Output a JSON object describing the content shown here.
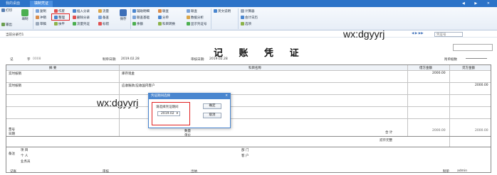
{
  "tabs": [
    "我的桌面",
    "填制凭证"
  ],
  "window_controls": "◀ ▶ ✕",
  "ribbon": {
    "left_small": [
      "打印",
      "输出"
    ],
    "left_big": [
      "填制"
    ],
    "group1": [
      {
        "label": "复制"
      },
      {
        "label": "冲销"
      },
      {
        "label": "草稿"
      }
    ],
    "group2": [
      {
        "label": "作废"
      },
      {
        "label": "整理"
      },
      {
        "label": "扶平"
      }
    ],
    "group3": [
      {
        "label": "插入分录"
      },
      {
        "label": "删除分录"
      },
      {
        "label": "流量凭证"
      }
    ],
    "group4": [
      {
        "label": "流量"
      },
      {
        "label": "备查"
      },
      {
        "label": "标错"
      }
    ],
    "save_big": "保存",
    "group5": [
      {
        "label": "辅助明细"
      },
      {
        "label": "联查基础"
      },
      {
        "label": "余额"
      }
    ],
    "group6": [
      {
        "label": "联查"
      },
      {
        "label": "分单"
      },
      {
        "label": "科目转换"
      }
    ],
    "group7": [
      {
        "label": "联查"
      },
      {
        "label": "数据分析"
      },
      {
        "label": "显示凭证号"
      }
    ],
    "group8": [
      {
        "label": "英文说明"
      }
    ],
    "group9": [
      {
        "label": "计算器"
      },
      {
        "label": "会计日历"
      },
      {
        "label": "选项"
      }
    ]
  },
  "subbar": {
    "label": "当前分录行1",
    "search_placeholder": "凭证号"
  },
  "watermarks": [
    "wx:dgyyrj",
    "wx:dgyyrj"
  ],
  "voucher": {
    "title": "记 账 凭 证",
    "type_label": "记",
    "number_label": "字",
    "number": "0008",
    "date_label": "制单日期:",
    "date": "2019.02.28",
    "audit_label": "审核日期:",
    "audit_date": "2019.02.28",
    "attach_label": "附单据数",
    "headers": {
      "summary": "摘 要",
      "account": "科目名称",
      "debit": "借方金额",
      "credit": "贷方金额"
    },
    "rows": [
      {
        "summary": "实时核销",
        "account": "库存现金",
        "debit": "2000.00",
        "credit": ""
      },
      {
        "summary": "实时核销",
        "account": "应收账款/应收国内客户",
        "debit": "",
        "credit": "2000.00"
      }
    ],
    "footer": {
      "ticket_no": "票号",
      "ticket_date": "日期",
      "qty": "数量",
      "unit_price": "单价",
      "total_label": "合 计",
      "total_debit": "2000.00",
      "total_credit": "2000.00",
      "capital_label": "贰仟元整",
      "remark": "备注",
      "project": "项 目",
      "dept": "部 门",
      "person": "个 人",
      "customer": "客 户",
      "business": "业务员"
    },
    "signature": {
      "bookkeep": "记账",
      "audit": "审核",
      "cashier": "出纳",
      "maker": "制单",
      "maker_name": "admin"
    }
  },
  "dialog": {
    "title": "凭证期间选择",
    "prompt": "请选择凭证期间",
    "period": "2019.02",
    "ok": "确定",
    "cancel": "取消"
  },
  "colors": {
    "tabbar": "#2c73c8",
    "dialog_border": "#4a86cf",
    "highlight": "#e02020"
  }
}
